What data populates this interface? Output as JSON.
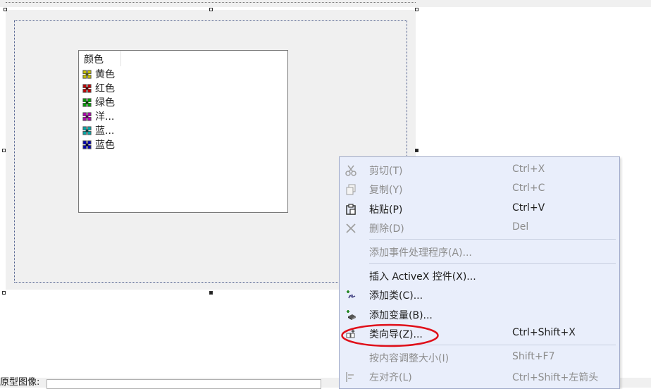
{
  "colors": {
    "menu_bg": "#e9eefb",
    "disabled_text": "#8d8d8d",
    "oval": "#e0101a"
  },
  "list": {
    "header": "颜色",
    "items": [
      {
        "label": "黄色",
        "icon": "yellow-flower-icon",
        "color": "#c8c000"
      },
      {
        "label": "红色",
        "icon": "red-flower-icon",
        "color": "#c00000"
      },
      {
        "label": "绿色",
        "icon": "green-flower-icon",
        "color": "#00a000"
      },
      {
        "label": "洋...",
        "icon": "magenta-flower-icon",
        "color": "#b000b0"
      },
      {
        "label": "蓝...",
        "icon": "cyan-flower-icon",
        "color": "#00a8a8"
      },
      {
        "label": "蓝色",
        "icon": "blue-flower-icon",
        "color": "#0000b0"
      }
    ]
  },
  "menu": {
    "items": [
      {
        "label": "剪切(T)",
        "shortcut": "Ctrl+X",
        "disabled": true,
        "icon": "scissors-icon"
      },
      {
        "label": "复制(Y)",
        "shortcut": "Ctrl+C",
        "disabled": true,
        "icon": "copy-icon"
      },
      {
        "label": "粘贴(P)",
        "shortcut": "Ctrl+V",
        "disabled": false,
        "icon": "paste-icon"
      },
      {
        "label": "删除(D)",
        "shortcut": "Del",
        "disabled": true,
        "icon": "delete-icon"
      },
      {
        "label": "添加事件处理程序(A)...",
        "shortcut": "",
        "disabled": true,
        "icon": ""
      },
      {
        "label": "插入 ActiveX 控件(X)...",
        "shortcut": "",
        "disabled": false,
        "icon": ""
      },
      {
        "label": "添加类(C)...",
        "shortcut": "",
        "disabled": false,
        "icon": "add-class-icon"
      },
      {
        "label": "添加变量(B)...",
        "shortcut": "",
        "disabled": false,
        "icon": "add-variable-icon"
      },
      {
        "label": "类向导(Z)...",
        "shortcut": "Ctrl+Shift+X",
        "disabled": false,
        "icon": "class-wizard-icon"
      },
      {
        "label": "按内容调整大小(I)",
        "shortcut": "Shift+F7",
        "disabled": true,
        "icon": ""
      },
      {
        "label": "左对齐(L)",
        "shortcut": "Ctrl+Shift+左箭头",
        "disabled": true,
        "icon": "align-left-icon"
      }
    ]
  },
  "status": {
    "label": "原型图像:"
  }
}
